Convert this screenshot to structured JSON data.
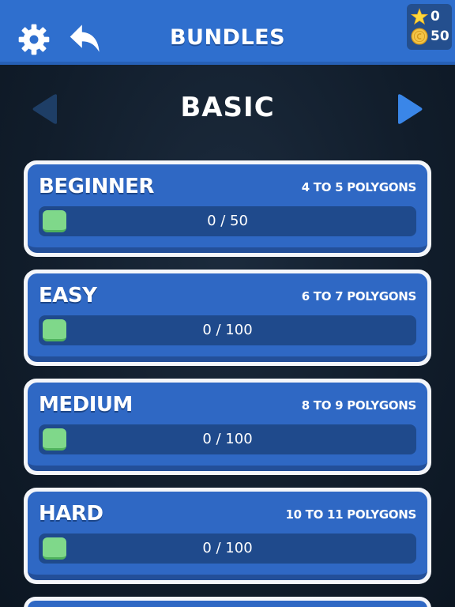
{
  "header": {
    "title": "BUNDLES",
    "settings_icon": "gear-icon",
    "back_icon": "reply-arrow-icon",
    "stars": "0",
    "coins": "50"
  },
  "category": {
    "title": "BASIC"
  },
  "bundles": [
    {
      "name": "BEGINNER",
      "range": "4 TO 5 POLYGONS",
      "progress": "0 / 50",
      "completed": 0,
      "total": 50
    },
    {
      "name": "EASY",
      "range": "6 TO 7 POLYGONS",
      "progress": "0 / 100",
      "completed": 0,
      "total": 100
    },
    {
      "name": "MEDIUM",
      "range": "8 TO 9 POLYGONS",
      "progress": "0 / 100",
      "completed": 0,
      "total": 100
    },
    {
      "name": "HARD",
      "range": "10 TO 11 POLYGONS",
      "progress": "0 / 100",
      "completed": 0,
      "total": 100
    }
  ],
  "colors": {
    "header": "#2f6fce",
    "card": "#2f68c4",
    "progress_fill": "#7fd88a",
    "background": "#111d2b"
  }
}
